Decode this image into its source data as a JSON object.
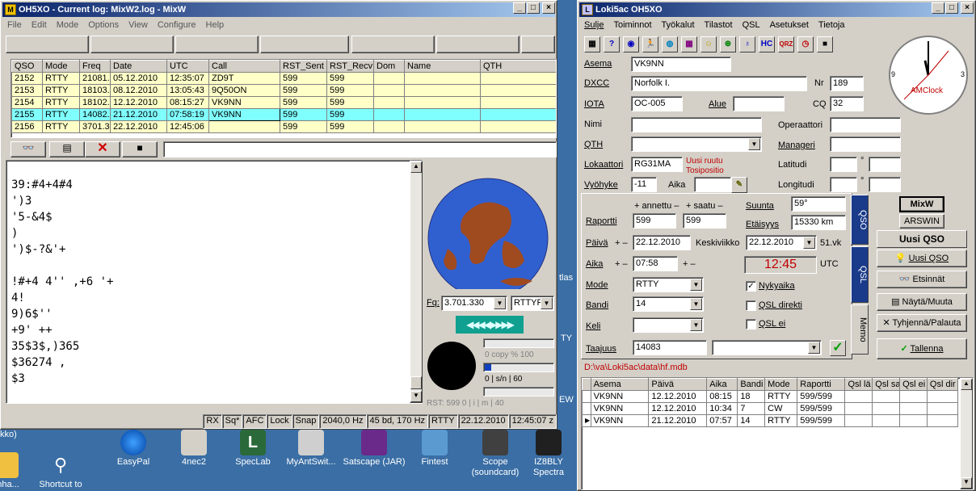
{
  "mixw": {
    "title": "OH5XO - Current log: MixW2.log - MixW",
    "menu": [
      "File",
      "Edit",
      "Mode",
      "Options",
      "View",
      "Configure",
      "Help"
    ],
    "log_columns": [
      "QSO",
      "Mode",
      "Freq",
      "Date",
      "UTC",
      "Call",
      "RST_Sent",
      "RST_Recv",
      "Dom",
      "Name",
      "QTH"
    ],
    "log_rows": [
      [
        "2152",
        "RTTY",
        "21081.",
        "05.12.2010",
        "12:35:07",
        "ZD9T",
        "599",
        "599",
        "",
        "",
        ""
      ],
      [
        "2153",
        "RTTY",
        "18103.",
        "08.12.2010",
        "13:05:43",
        "9Q50ON",
        "599",
        "599",
        "",
        "",
        ""
      ],
      [
        "2154",
        "RTTY",
        "18102.",
        "12.12.2010",
        "08:15:27",
        "VK9NN",
        "599",
        "599",
        "",
        "",
        ""
      ],
      [
        "2155",
        "RTTY",
        "14082.",
        "21.12.2010",
        "07:58:19",
        "VK9NN",
        "599",
        "599",
        "",
        "",
        ""
      ],
      [
        "2156",
        "RTTY",
        "3701.3",
        "22.12.2010",
        "12:45:06",
        "",
        "599",
        "599",
        "",
        "",
        ""
      ]
    ],
    "rx_lines": [
      "39:#4+4#4",
      "')3",
      "'5-&4$",
      ")",
      "')$-?&'+",
      "",
      "!#+4 4'' ,+6 '+",
      "4!",
      "9)6$''",
      "+9' ++",
      "35$3$,)365",
      "$36274 ,",
      "$3"
    ],
    "freq_label": "Fq:",
    "freq_value": "3.701.330",
    "mode_value": "RTTYF",
    "copy_label": "0  copy %  100",
    "sn_label": "0   | s/n |   60",
    "imd_label": "RST: 599    0    | i | m |  40",
    "status": [
      "RX",
      "Sq*",
      "AFC",
      "Lock",
      "Snap",
      "2040,0 Hz",
      "45 bd, 170 Hz",
      "RTTY",
      "22.12.2010",
      "12:45:07 z"
    ]
  },
  "desktop": {
    "icons": [
      "EasyPal",
      "4nec2",
      "SpecLab",
      "MyAntSwit...",
      "Satscape (JAR)",
      "Fintest",
      "Scope (soundcard)",
      "IZ8BLY Spectra"
    ],
    "left_icons": [
      "onha...",
      "Shortcut to"
    ],
    "edge_labels": [
      "tlas",
      "TY",
      "EW",
      "kko)"
    ]
  },
  "loki": {
    "title": "Loki5ac OH5XO",
    "menu": [
      "Sulje",
      "Toiminnot",
      "Työkalut",
      "Tilastot",
      "QSL",
      "Asetukset",
      "Tietoja"
    ],
    "toolbar_icons": [
      "HC",
      "QRZ"
    ],
    "clock_brand": "AMClock",
    "clock_labels": [
      "9",
      "3"
    ],
    "labels": {
      "asema": "Asema",
      "dxcc": "DXCC",
      "nr": "Nr",
      "iota": "IOTA",
      "alue": "Alue",
      "cq": "CQ",
      "nimi": "Nimi",
      "operaattori": "Operaattori",
      "qth": "QTH",
      "manageri": "Manageri",
      "lokaattori": "Lokaattori",
      "latitudi": "Latitudi",
      "vyohyke": "Vyöhyke",
      "aika": "Aika",
      "longitudi": "Longitudi",
      "annettu": "+ annettu –",
      "saatu": "+ saatu –",
      "suunta": "Suunta",
      "etaisyys": "Etäisyys",
      "raportti": "Raportti",
      "paiva": "Päivä",
      "aika2": "Aika",
      "pm": "+ –",
      "pm2": "+ –",
      "viikonpaiva": "Keskiviikko",
      "viikko": "51.vk",
      "utc": "UTC",
      "mode": "Mode",
      "nykyaika": "Nykyaika",
      "bandi": "Bandi",
      "qsl_direkti": "QSL direkti",
      "keli": "Keli",
      "qsl_ei": "QSL ei",
      "taajuus": "Taajuus",
      "deg1": "°",
      "deg2": "°"
    },
    "values": {
      "asema": "VK9NN",
      "dxcc": "Norfolk I.",
      "nr": "189",
      "iota": "OC-005",
      "cq": "32",
      "lokaattori": "RG31MA",
      "vyohyke": "-11",
      "raportti_annettu": "599",
      "raportti_saatu": "599",
      "suunta": "59°",
      "etaisyys": "15330 km",
      "paiva": "22.12.2010",
      "paiva2": "22.12.2010",
      "aika": "07:58",
      "clock": "12:45",
      "mode": "RTTY",
      "bandi": "14",
      "taajuus": "14083"
    },
    "locator_note": [
      "Uusi ruutu",
      "Tosipositio"
    ],
    "tabs": [
      "QSO",
      "QSL",
      "Memo"
    ],
    "right_buttons": {
      "mixw": "MixW",
      "arswin": "ARSWIN",
      "uusi_header": "Uusi QSO",
      "uusi": "Uusi QSO",
      "etsinnat": "Etsinnät",
      "nayta": "Näytä/Muuta",
      "tyhjenna": "Tyhjennä/Palauta",
      "tallenna": "Tallenna"
    },
    "db_path": "D:\\va\\Loki5ac\\data\\hf.mdb",
    "grid_columns": [
      "Asema",
      "Päivä",
      "Aika",
      "Bandi",
      "Mode",
      "Raportti",
      "Qsl lä",
      "Qsl sa",
      "Qsl ei",
      "Qsl dir"
    ],
    "grid_rows": [
      [
        "VK9NN",
        "12.12.2010",
        "08:15",
        "18",
        "RTTY",
        "599/599",
        "",
        "",
        "",
        ""
      ],
      [
        "VK9NN",
        "12.12.2010",
        "10:34",
        "7",
        "CW",
        "599/599",
        "",
        "",
        "",
        ""
      ],
      [
        "VK9NN",
        "21.12.2010",
        "07:57",
        "14",
        "RTTY",
        "599/599",
        "",
        "",
        "",
        ""
      ]
    ]
  }
}
